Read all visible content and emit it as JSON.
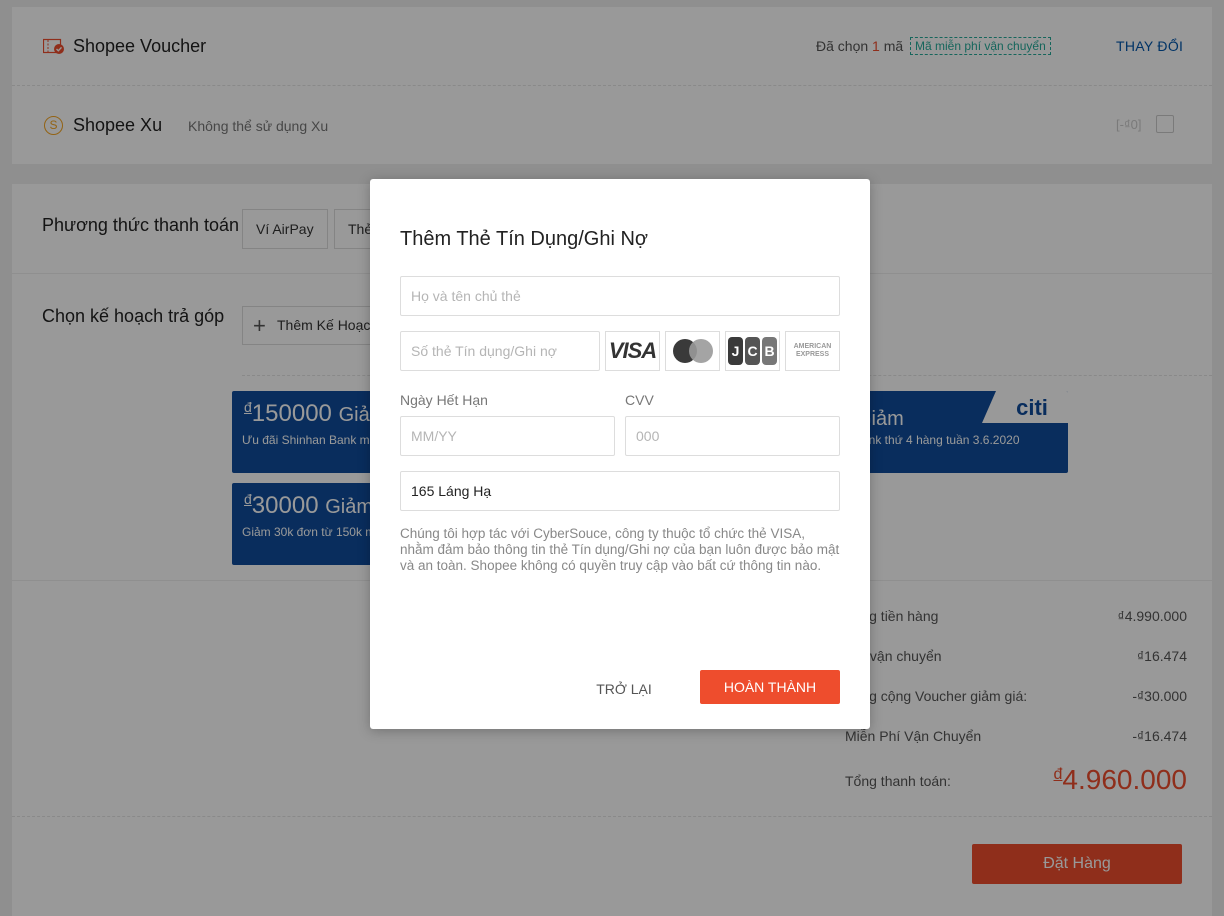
{
  "voucher": {
    "title": "Shopee Voucher",
    "selected_prefix": "Đã chọn",
    "selected_count": "1",
    "selected_suffix": "mã",
    "tag": "Mã miễn phí vận chuyển",
    "change_label": "THAY ĐỔI"
  },
  "xu": {
    "icon_glyph": "S",
    "title": "Shopee Xu",
    "note": "Không thể sử dụng Xu",
    "amount": "[-₫0]"
  },
  "payment": {
    "label": "Phương thức thanh toán",
    "methods": [
      "Ví AirPay",
      "Thẻ"
    ]
  },
  "installment": {
    "label": "Chọn kế hoạch trả góp",
    "add_label": "Thêm Kế Hoạch",
    "promos": [
      {
        "currency": "đ",
        "amount": "150000",
        "word": "Giảm",
        "desc": "Ưu đãi Shinhan Bank m"
      },
      {
        "word": "Giảm",
        "desc": "ank thứ 4 hàng tuần 3.6.2020",
        "logo": "citi"
      },
      {
        "currency": "đ",
        "amount": "30000",
        "word": "Giảm",
        "desc": "Giảm 30k đơn từ 150k m"
      }
    ]
  },
  "summary": {
    "rows": [
      {
        "label": "Tổng tiền hàng",
        "value": "₫4.990.000"
      },
      {
        "label": "Phí vận chuyển",
        "value": "₫16.474"
      },
      {
        "label": "Tổng cộng Voucher giảm giá:",
        "value": "-₫30.000"
      },
      {
        "label": "Miễn Phí Vận Chuyển",
        "value": "-₫16.474"
      }
    ],
    "total_label": "Tổng thanh toán:",
    "total_currency": "đ",
    "total_value": "4.960.000",
    "order_button": "Đặt Hàng"
  },
  "modal": {
    "title": "Thêm Thẻ Tín Dụng/Ghi Nợ",
    "name_placeholder": "Họ và tên chủ thẻ",
    "card_placeholder": "Số thẻ Tín dụng/Ghi nợ",
    "card_brands": [
      "VISA",
      "MasterCard",
      "JCB",
      "AMERICAN EXPRESS"
    ],
    "expiry_label": "Ngày Hết Hạn",
    "expiry_placeholder": "MM/YY",
    "cvv_label": "CVV",
    "cvv_placeholder": "000",
    "address_value": "165 Láng Hạ",
    "disclaimer": "Chúng tôi hợp tác với CyberSouce, công ty thuộc tổ chức thẻ VISA, nhằm đảm bảo thông tin thẻ Tín dụng/Ghi nợ của bạn luôn được bảo mật và an toàn. Shopee không có quyền truy cập vào bất cứ thông tin nào.",
    "back_label": "Trở lại",
    "done_label": "HOÀN THÀNH"
  },
  "colors": {
    "accent": "#ee4d2d",
    "link": "#0055aa",
    "teal": "#26aa99",
    "bank_blue": "#0f4c9b",
    "xu_orange": "#f5a623"
  }
}
